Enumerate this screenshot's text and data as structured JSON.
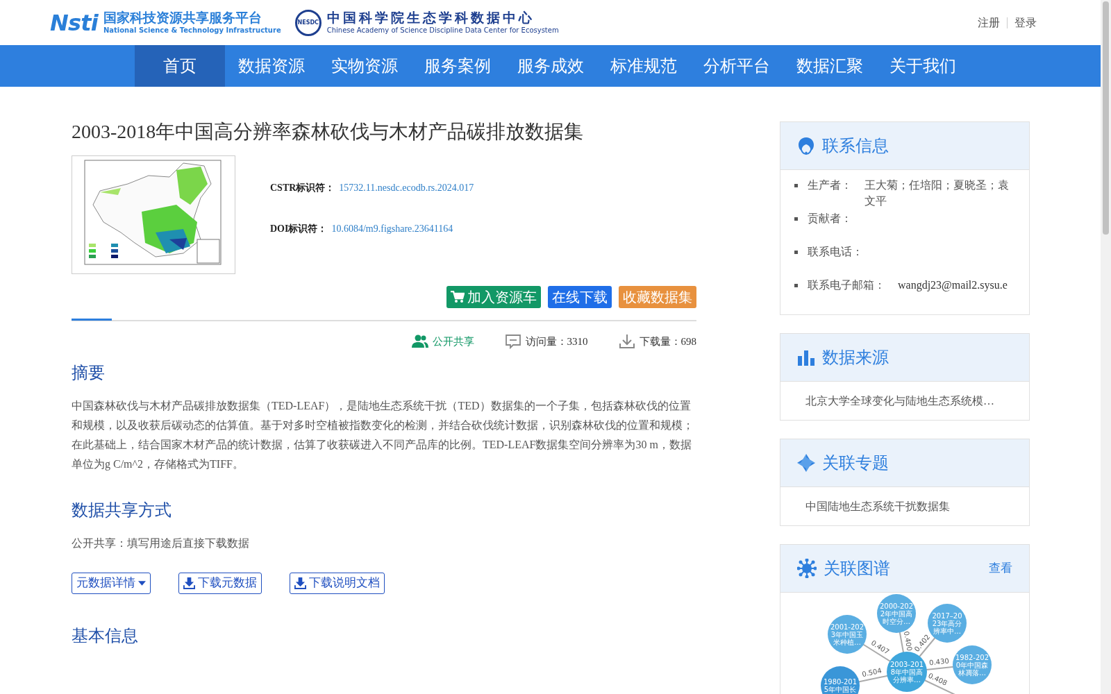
{
  "header": {
    "logo_mark": "Nsti",
    "logo_cn": "国家科技资源共享服务平台",
    "logo_en": "National Science & Technology Infrastructure",
    "badge": "NESDC",
    "center_cn": "中国科学院生态学科数据中心",
    "center_en": "Chinese Academy of Science Discipline Data Center for Ecosystem",
    "links": [
      "注册",
      "登录"
    ]
  },
  "nav": [
    {
      "label": "首页",
      "selected": true
    },
    {
      "label": "数据资源",
      "selected": false
    },
    {
      "label": "实物资源",
      "selected": false
    },
    {
      "label": "服务案例",
      "selected": false
    },
    {
      "label": "服务成效",
      "selected": false
    },
    {
      "label": "标准规范",
      "selected": false
    },
    {
      "label": "分析平台",
      "selected": false
    },
    {
      "label": "数据汇聚",
      "selected": false
    },
    {
      "label": "关于我们",
      "selected": false
    }
  ],
  "dataset": {
    "title": "2003-2018年中国高分辨率森林砍伐与木材产品碳排放数据集",
    "identifiers": [
      {
        "label": "CSTR标识符：",
        "value": "15732.11.nesdc.ecodb.rs.2024.017"
      },
      {
        "label": "DOI标识符：",
        "value": "10.6084/m9.figshare.23641164"
      }
    ],
    "actions": [
      {
        "kind": "cart",
        "label": "加入资源车"
      },
      {
        "kind": "download",
        "label": "在线下载"
      },
      {
        "kind": "favorite",
        "label": "收藏数据集"
      }
    ],
    "stats": [
      {
        "kind": "share",
        "label": "公开共享"
      },
      {
        "kind": "visits",
        "label": "访问量：",
        "value": "3310"
      },
      {
        "kind": "downloads",
        "label": "下载量：",
        "value": "698"
      }
    ],
    "sections": [
      {
        "heading": "摘要",
        "text": "中国森林砍伐与木材产品碳排放数据集（TED-LEAF），是陆地生态系统干扰（TED）数据集的一个子集，包括森林砍伐的位置和规模，以及收获后碳动态的估算值。基于对多时空植被指数变化的检测，并结合砍伐统计数据，识别森林砍伐的位置和规模；在此基础上，结合国家木材产品的统计数据，估算了收获碳进入不同产品库的比例。TED-LEAF数据集空间分辨率为30 m，数据单位为g C/m^2，存储格式为TIFF。"
      },
      {
        "heading": "数据共享方式",
        "text": "公开共享：填写用途后直接下载数据",
        "buttons": [
          {
            "kind": "dropdown",
            "label": "元数据详情"
          },
          {
            "kind": "download",
            "label": "下载元数据"
          },
          {
            "kind": "download",
            "label": "下载说明文档"
          }
        ]
      },
      {
        "heading": "基本信息"
      }
    ]
  },
  "sidebar": {
    "contact": {
      "title": "联系信息",
      "items": [
        {
          "label": "生产者：",
          "value": "王大菊；任培阳；夏晓圣；袁文平"
        },
        {
          "label": "贡献者："
        },
        {
          "label": "联系电话："
        },
        {
          "label": "联系电子邮箱：",
          "value": "wangdj23@mail2.sysu.e"
        }
      ]
    },
    "source": {
      "title": "数据来源",
      "items": [
        "北京大学全球变化与陆地生态系统模…"
      ]
    },
    "topic": {
      "title": "关联专题",
      "items": [
        "中国陆地生态系统干扰数据集"
      ]
    },
    "graph": {
      "title": "关联图谱",
      "action": "查看",
      "center": {
        "lines": [
          "2003-201",
          "8年中国高",
          "分辨率…"
        ],
        "color": "#3fa6dc"
      },
      "nodes": [
        {
          "lines": [
            "2000-202",
            "2年中国高",
            "时空分…"
          ],
          "color": "#5aaee2",
          "edge": "0.400"
        },
        {
          "lines": [
            "2017–20",
            "23年高分",
            "辨率中…"
          ],
          "color": "#5aaee2",
          "edge": "0.402"
        },
        {
          "lines": [
            "2001-202",
            "3年中国玉",
            "米种植…"
          ],
          "color": "#5aaee2",
          "edge": "0.407"
        },
        {
          "lines": [
            "1982-202",
            "0年中国森",
            "林凋落…"
          ],
          "color": "#5aaee2",
          "edge": "0.430"
        },
        {
          "lines": [
            "1980-201",
            "5年中国长"
          ],
          "color": "#3a96d8",
          "edge": "0.504"
        }
      ],
      "extra_edges": [
        "0.408"
      ]
    }
  }
}
